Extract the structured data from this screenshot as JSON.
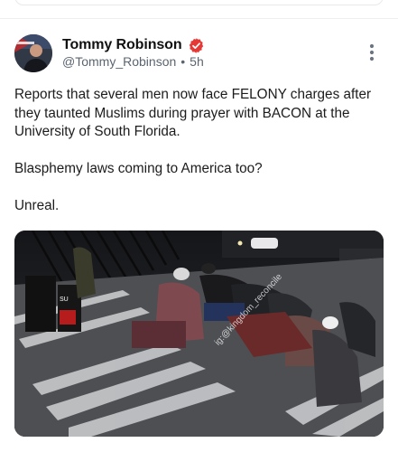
{
  "post": {
    "author_name": "Tommy Robinson",
    "handle": "@Tommy_Robinson",
    "separator": "•",
    "time": "5h",
    "paragraphs": [
      "Reports that several men now face FELONY charges after they taunted Muslims during prayer with BACON at the University of South Florida.",
      "Blasphemy laws coming to America too?",
      "Unreal."
    ],
    "media": {
      "watermark": "ig:@kingdom_reconcile"
    }
  },
  "colors": {
    "verified_badge": "#e53935",
    "secondary_text": "#5b6570",
    "border": "#e6e9ec"
  },
  "icons": {
    "verified": "verified-badge-icon",
    "more": "more-vertical-icon"
  }
}
